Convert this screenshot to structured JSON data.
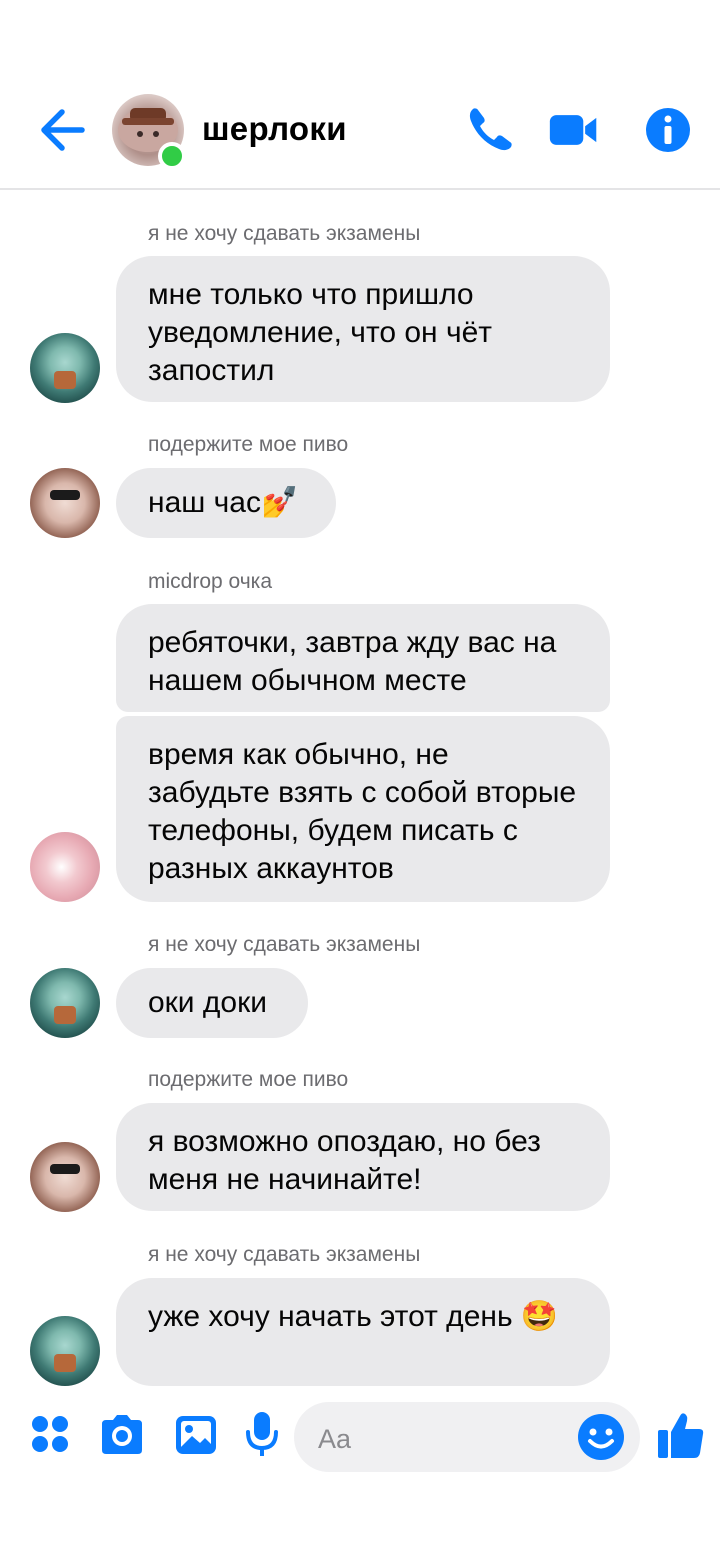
{
  "header": {
    "title": "шерлоки",
    "icons": [
      "back-arrow-icon",
      "phone-icon",
      "video-camera-icon",
      "info-icon"
    ],
    "accent": "#0a7cff"
  },
  "messages": [
    {
      "sender": "я не хочу сдавать экзамены",
      "avatar": "squidward",
      "bubbles": [
        "мне только что пришло уведомление, что он чёт запостил"
      ]
    },
    {
      "sender": "подержите мое пиво",
      "avatar": "girl-sunglasses",
      "bubbles": [
        "наш час💅"
      ]
    },
    {
      "sender": "micdrop очка",
      "avatar": "pink",
      "bubbles": [
        "ребяточки, завтра жду вас на нашем обычном месте",
        "время как обычно, не забудьте взять с собой вторые телефоны, будем писать с разных аккаунтов"
      ]
    },
    {
      "sender": "я не хочу сдавать экзамены",
      "avatar": "squidward",
      "bubbles": [
        "оки доки"
      ]
    },
    {
      "sender": "подержите мое пиво",
      "avatar": "girl-sunglasses",
      "bubbles": [
        "я возможно опоздаю, но без меня не начинайте!"
      ]
    },
    {
      "sender": "я не хочу сдавать экзамены",
      "avatar": "squidward",
      "bubbles": [
        "уже хочу начать этот день 🤩"
      ]
    }
  ],
  "composer": {
    "placeholder": "Aa",
    "icons": [
      "apps-icon",
      "camera-icon",
      "gallery-icon",
      "microphone-icon",
      "emoji-icon",
      "like-icon"
    ]
  },
  "colors": {
    "bubble": "#e9e9eb",
    "accent": "#0a7cff",
    "online": "#31cc46",
    "meta": "#6c6c70"
  }
}
